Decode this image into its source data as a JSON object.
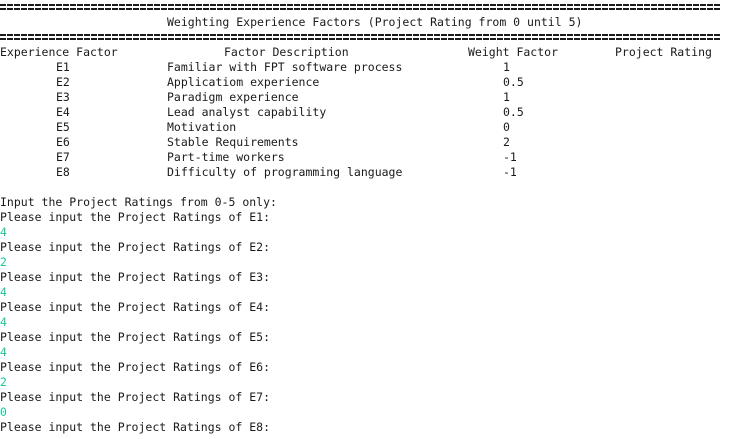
{
  "title": "Weighting Experience Factors (Project Rating from 0 until 5)",
  "headers": {
    "factor": "Experience Factor",
    "description": "Factor Description",
    "weight": "Weight Factor",
    "rating": "Project Rating"
  },
  "rows": [
    {
      "factor": "E1",
      "description": "Familiar with FPT software process",
      "weight": "1"
    },
    {
      "factor": "E2",
      "description": "Applicatiom experience",
      "weight": "0.5"
    },
    {
      "factor": "E3",
      "description": "Paradigm experience",
      "weight": "1"
    },
    {
      "factor": "E4",
      "description": "Lead analyst capability",
      "weight": "0.5"
    },
    {
      "factor": "E5",
      "description": "Motivation",
      "weight": "0"
    },
    {
      "factor": "E6",
      "description": "Stable Requirements",
      "weight": "2"
    },
    {
      "factor": "E7",
      "description": "Part-time workers",
      "weight": "-1"
    },
    {
      "factor": "E8",
      "description": "Difficulty of programming language",
      "weight": "-1"
    }
  ],
  "instruction": "Input the Project Ratings from 0-5 only:",
  "prompts": [
    {
      "label": "Please input the Project Ratings of E1:",
      "value": "4"
    },
    {
      "label": "Please input the Project Ratings of E2:",
      "value": "2"
    },
    {
      "label": "Please input the Project Ratings of E3:",
      "value": "4"
    },
    {
      "label": "Please input the Project Ratings of E4:",
      "value": "4"
    },
    {
      "label": "Please input the Project Ratings of E5:",
      "value": "4"
    },
    {
      "label": "Please input the Project Ratings of E6:",
      "value": "2"
    },
    {
      "label": "Please input the Project Ratings of E7:",
      "value": "0"
    },
    {
      "label": "Please input the Project Ratings of E8:",
      "value": ""
    }
  ],
  "colors": {
    "text": "#1a1a1a",
    "input": "#16c79a",
    "background": "#ffffff"
  }
}
